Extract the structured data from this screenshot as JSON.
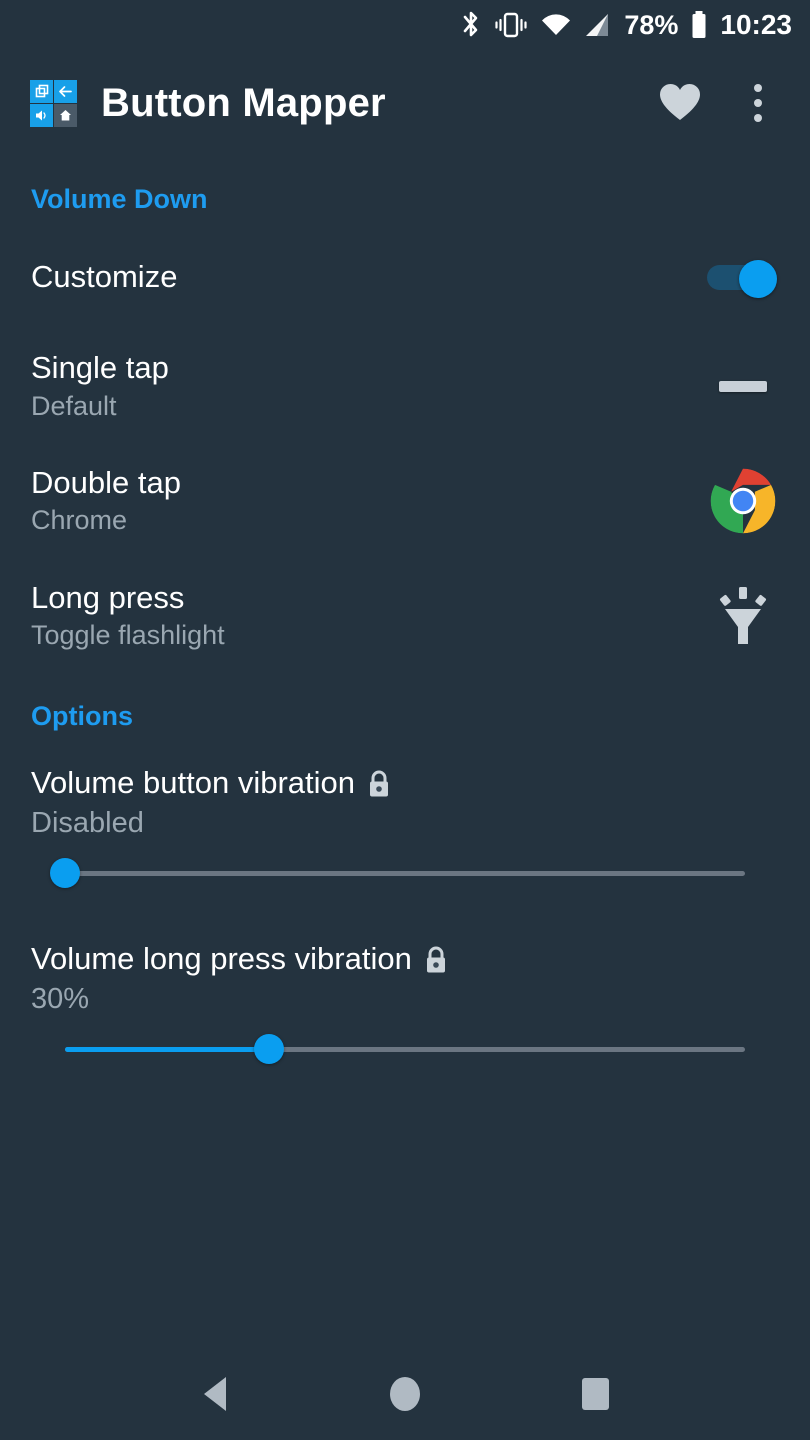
{
  "status_bar": {
    "bluetooth_icon": "bluetooth-icon",
    "vibrate_icon": "vibrate-icon",
    "wifi_icon": "wifi-icon",
    "signal_icon": "cellular-signal-icon",
    "battery_percent": "78%",
    "battery_icon": "battery-icon",
    "clock": "10:23"
  },
  "app_bar": {
    "title": "Button Mapper",
    "app_icon": "button-mapper-app-icon",
    "favorite_icon": "heart-icon",
    "overflow_icon": "overflow-menu-icon"
  },
  "sections": [
    {
      "header": "Volume Down",
      "rows": [
        {
          "title": "Customize",
          "subtitle": "",
          "accessory": "toggle",
          "toggle_on": true
        },
        {
          "title": "Single tap",
          "subtitle": "Default",
          "accessory": "dash",
          "accessory_icon": "dash-icon"
        },
        {
          "title": "Double tap",
          "subtitle": "Chrome",
          "accessory": "chrome",
          "accessory_icon": "chrome-icon"
        },
        {
          "title": "Long press",
          "subtitle": "Toggle flashlight",
          "accessory": "flashlight",
          "accessory_icon": "flashlight-icon"
        }
      ]
    },
    {
      "header": "Options",
      "sliders": [
        {
          "title": "Volume button vibration",
          "lock_icon": "lock-icon",
          "value_label": "Disabled",
          "percent": 0
        },
        {
          "title": "Volume long press vibration",
          "lock_icon": "lock-icon",
          "value_label": "30%",
          "percent": 30
        }
      ]
    }
  ],
  "nav_bar": {
    "back": "back-nav-icon",
    "home": "home-nav-icon",
    "recents": "recents-nav-icon"
  },
  "colors": {
    "background": "#24333f",
    "accent": "#1e9cf0",
    "slider_active": "#0a9ef0",
    "secondary_text": "#9aa7b1"
  }
}
